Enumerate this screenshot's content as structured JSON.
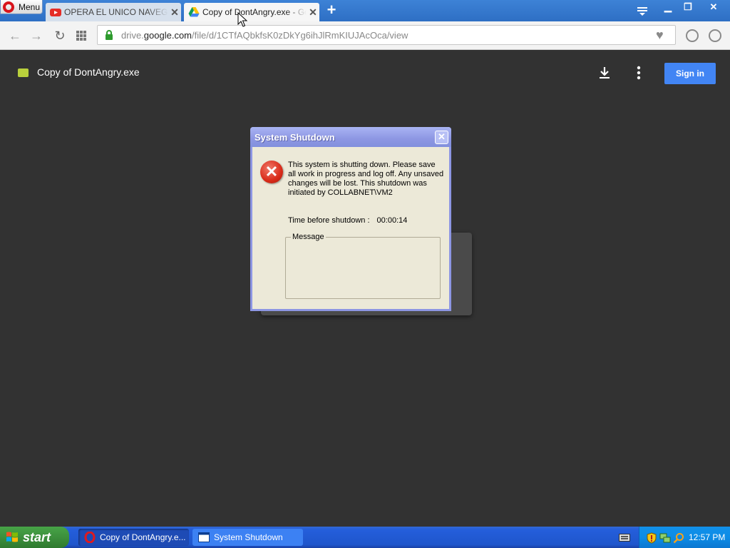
{
  "browser": {
    "menu_label": "Menu",
    "tabs": [
      {
        "title": "OPERA EL UNICO NAVEGADOR",
        "active": false
      },
      {
        "title": "Copy of DontAngry.exe - Google Drive",
        "active": true
      }
    ],
    "url_prefix": "drive.",
    "url_host": "google.com",
    "url_path": "/file/d/1CTfAQbkfsK0zDkYg6ihJlRmKIUJAcOca/view"
  },
  "drive": {
    "file_title": "Copy of DontAngry.exe",
    "signin_label": "Sign in",
    "accent_color": "#4285f4"
  },
  "dialog": {
    "title": "System Shutdown",
    "message": "This system is shutting down. Please save all work in progress and log off. Any unsaved changes will be lost. This shutdown was initiated by COLLABNET\\VM2",
    "time_label": "Time before shutdown :",
    "time_value": "00:00:14",
    "group_label": "Message"
  },
  "taskbar": {
    "start_label": "start",
    "tasks": [
      {
        "label": "Copy of DontAngry.e...",
        "icon": "opera-icon"
      },
      {
        "label": "System Shutdown",
        "icon": "window-icon"
      }
    ],
    "clock": "12:57 PM"
  }
}
